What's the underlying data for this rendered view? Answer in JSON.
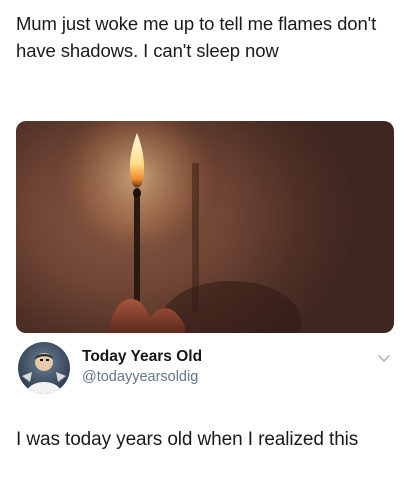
{
  "meme": {
    "caption": "Mum just woke me up to tell me flames don't have shadows. I can't sleep now"
  },
  "photo": {
    "description_icon": "lit-match-image"
  },
  "tweet": {
    "display_name": "Today Years Old",
    "handle": "@todayyearsoldig",
    "text": "I was today years old when I realized this",
    "menu_icon": "chevron-down-icon"
  },
  "colors": {
    "handle_gray": "#657786",
    "text_dark": "#14171a"
  }
}
